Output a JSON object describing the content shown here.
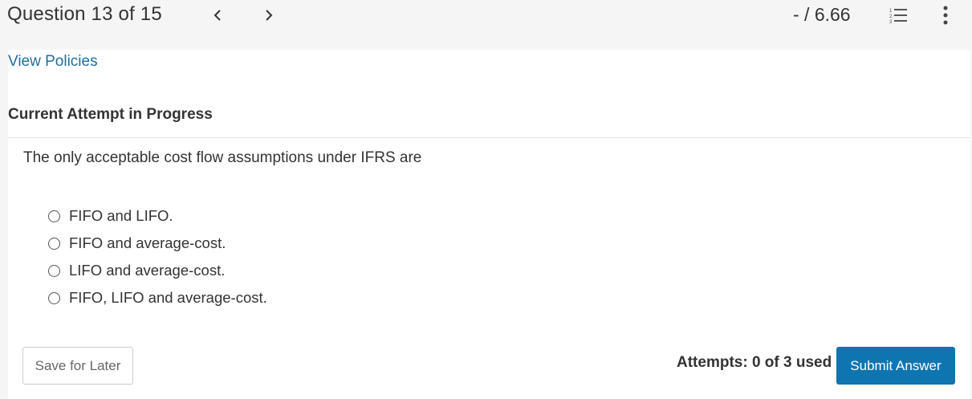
{
  "header": {
    "question_title": "Question 13 of 15",
    "score": "- / 6.66",
    "icons": {
      "prev": "chevron-left-icon",
      "next": "chevron-right-icon",
      "list": "numbered-list-icon",
      "more": "more-vertical-icon"
    }
  },
  "links": {
    "view_policies": "View Policies"
  },
  "attempt": {
    "heading": "Current Attempt in Progress"
  },
  "question": {
    "text": "The only acceptable cost flow assumptions under IFRS are",
    "options": [
      {
        "label": "FIFO and LIFO."
      },
      {
        "label": "FIFO and average-cost."
      },
      {
        "label": "LIFO and average-cost."
      },
      {
        "label": "FIFO, LIFO and average-cost."
      }
    ]
  },
  "footer": {
    "save_label": "Save for Later",
    "attempts_text": "Attempts: 0 of 3 used",
    "submit_label": "Submit Answer"
  },
  "colors": {
    "accent": "#0f75b0",
    "link": "#1f6f9f",
    "background": "#f5f5f5",
    "panel": "#ffffff"
  }
}
